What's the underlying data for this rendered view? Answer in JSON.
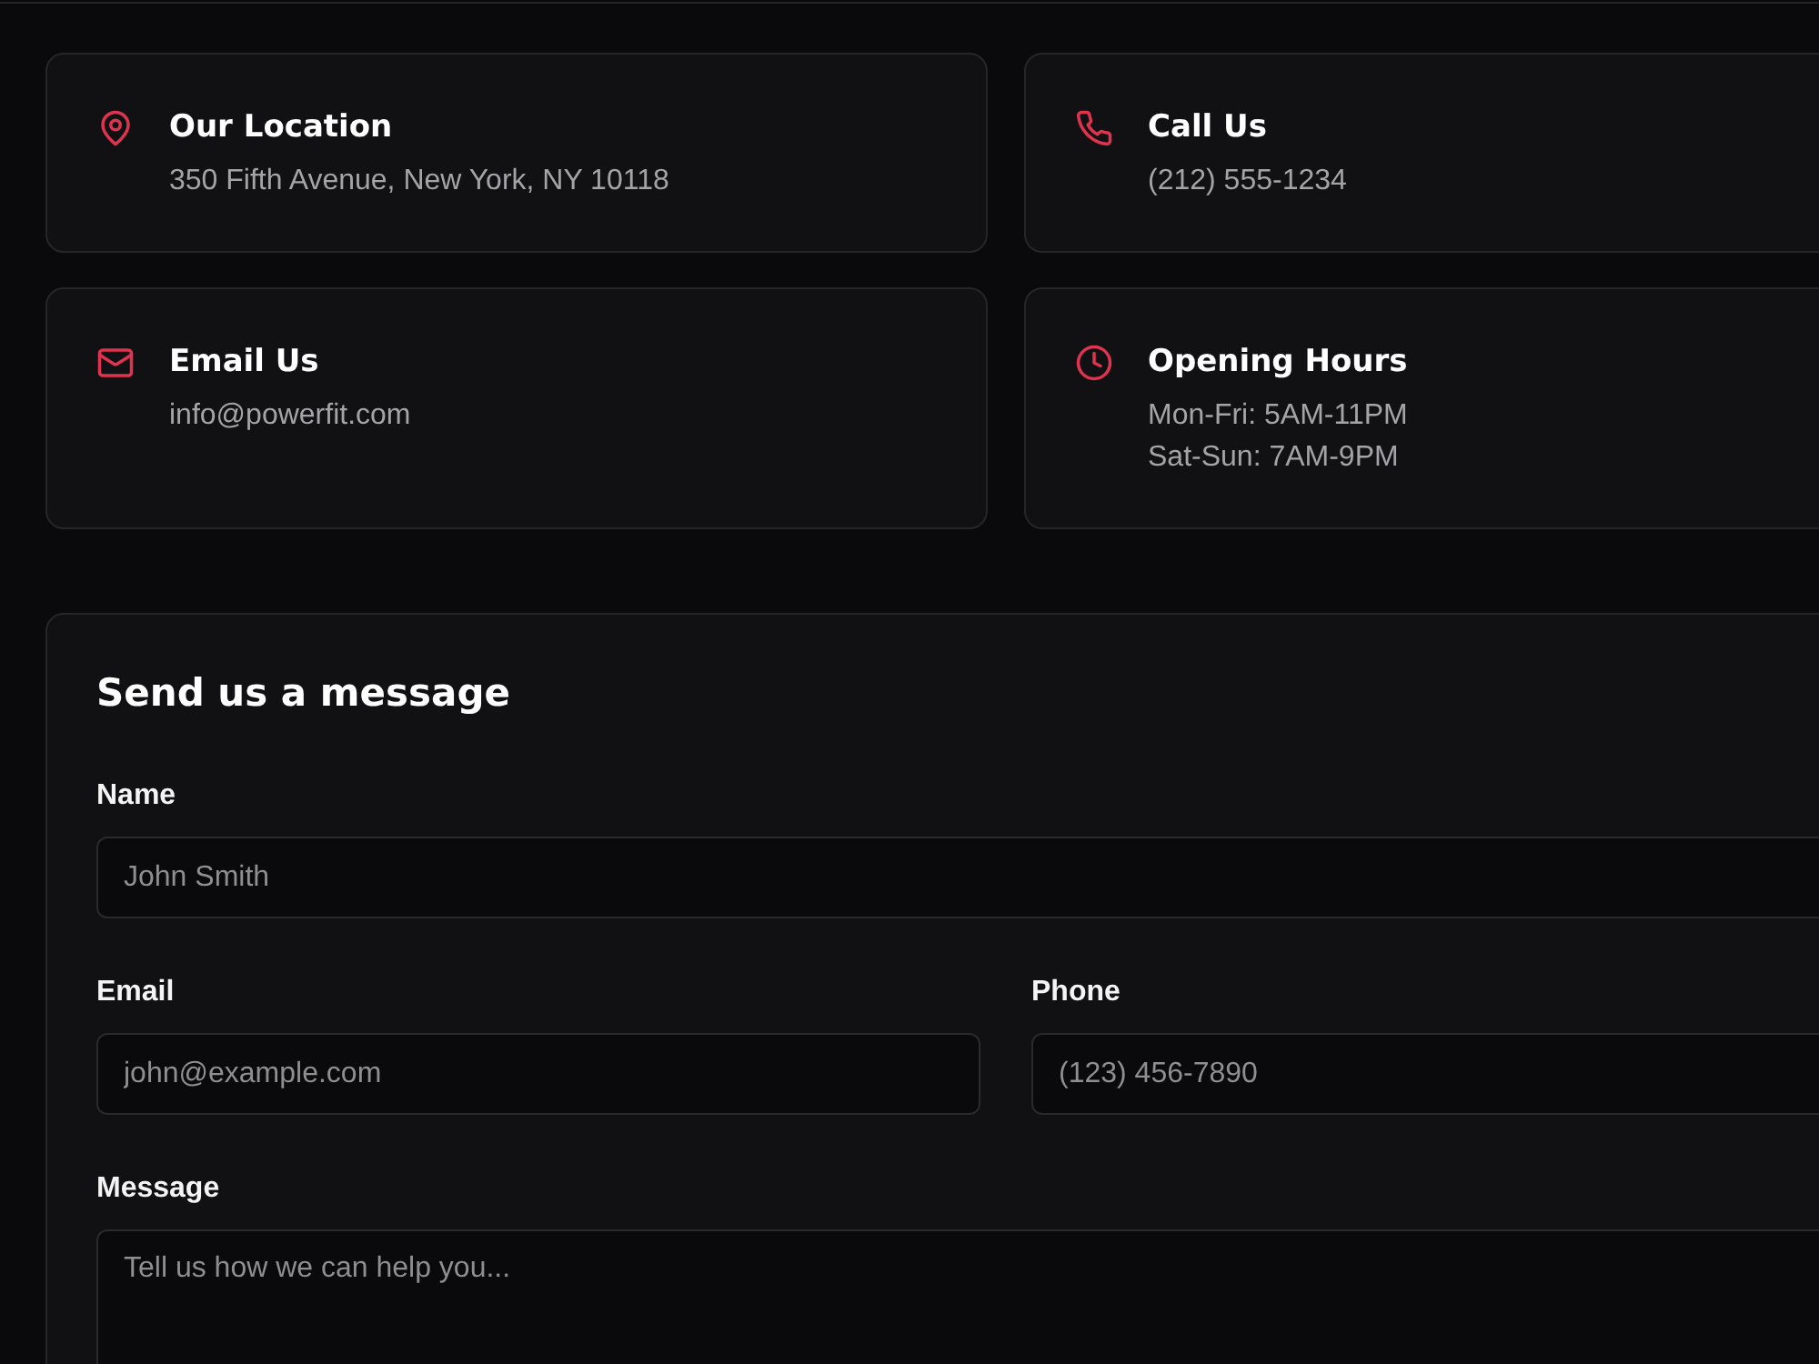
{
  "contact_cards": [
    {
      "kind": "location",
      "title": "Our Location",
      "lines": [
        "350 Fifth Avenue, New York, NY 10118"
      ]
    },
    {
      "kind": "phone",
      "title": "Call Us",
      "lines": [
        "(212) 555-1234"
      ]
    },
    {
      "kind": "email",
      "title": "Email Us",
      "lines": [
        "info@powerfit.com"
      ]
    },
    {
      "kind": "clock",
      "title": "Opening Hours",
      "lines": [
        "Mon-Fri: 5AM-11PM",
        "Sat-Sun: 7AM-9PM"
      ]
    }
  ],
  "form": {
    "title": "Send us a message",
    "rows": [
      [
        {
          "kind": "text",
          "label": "Name",
          "placeholder": "John Smith"
        }
      ],
      [
        {
          "kind": "text",
          "label": "Email",
          "placeholder": "john@example.com"
        },
        {
          "kind": "text",
          "label": "Phone",
          "placeholder": "(123) 456-7890"
        }
      ],
      [
        {
          "kind": "textarea",
          "label": "Message",
          "placeholder": "Tell us how we can help you..."
        }
      ]
    ]
  }
}
